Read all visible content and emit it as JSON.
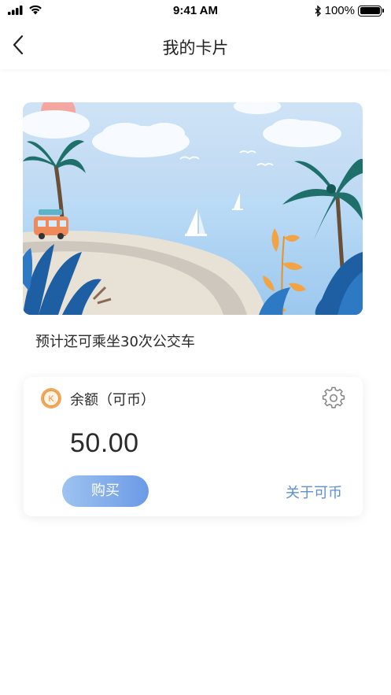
{
  "status_bar": {
    "time": "9:41 AM",
    "battery": "100%",
    "icons": [
      "signal-icon",
      "wifi-icon",
      "bluetooth-icon",
      "battery-icon"
    ]
  },
  "nav": {
    "title": "我的卡片",
    "back_icon": "chevron-left-icon"
  },
  "card": {
    "image": "beach-illustration",
    "trips_text": "预计还可乘坐30次公交车"
  },
  "balance": {
    "label": "余额（可币）",
    "value": "50.00",
    "coin_icon": "coin-icon",
    "coin_letter": "K",
    "settings_icon": "gear-icon",
    "buy_label": "购买",
    "about_label": "关于可币"
  },
  "colors": {
    "accent": "#5c8fd6",
    "button_gradient_start": "#9ec3f0",
    "button_gradient_end": "#6b9ae6",
    "coin": "#f0a85a"
  }
}
